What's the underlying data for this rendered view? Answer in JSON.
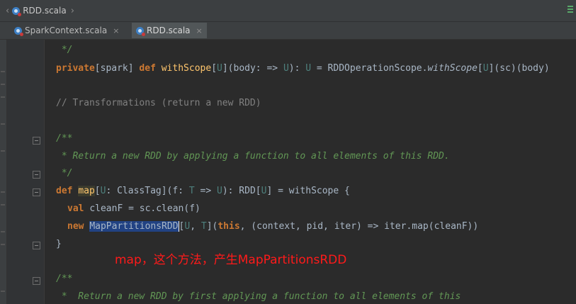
{
  "breadcrumb": {
    "file": "RDD.scala"
  },
  "tabs": [
    {
      "label": "SparkContext.scala",
      "close": "×"
    },
    {
      "label": "RDD.scala",
      "close": "×"
    }
  ],
  "code": {
    "l1": {
      "t1": " */"
    },
    "l2": {
      "t1": "private",
      "t2": "[spark] ",
      "t3": "def ",
      "t4": "withScope",
      "t5": "[",
      "t6": "U",
      "t7": "](body: => ",
      "t8": "U",
      "t9": "): ",
      "t10": "U",
      "t11": " = RDDOperationScope.",
      "t12": "withScope",
      "t13": "[",
      "t14": "U",
      "t15": "](sc)(body)"
    },
    "l3": {
      "t1": "// Transformations (return a new RDD)"
    },
    "l4": {
      "t1": "/**"
    },
    "l5": {
      "t1": " * Return a new RDD by applying a function to all elements of this RDD."
    },
    "l6": {
      "t1": " */"
    },
    "l7": {
      "t1": "def ",
      "t2": "map",
      "t3": "[",
      "t4": "U",
      "t5": ": ClassTag](f: ",
      "t6": "T",
      "t7": " => ",
      "t8": "U",
      "t9": "): RDD[",
      "t10": "U",
      "t11": "] = withScope {"
    },
    "l8": {
      "t1": "val ",
      "t2": "cleanF = sc.clean(f)"
    },
    "l9": {
      "t1": "new ",
      "t2": "MapPartitionsRDD",
      "t3": "[",
      "t4": "U",
      "t5": ", ",
      "t6": "T",
      "t7": "](",
      "t8": "this",
      "t9": ", (context, pid, iter) => iter.map(cleanF))"
    },
    "l10": {
      "t1": "}"
    },
    "l11": {
      "t1": "/**"
    },
    "l12": {
      "t1": " *  Return a new RDD by first applying a function to all elements of this"
    }
  },
  "annotation": "map，这个方法，产生MapPartitionsRDD",
  "colors": {
    "keyword": "#cc7832",
    "function": "#ffc66d",
    "type_param": "#4e807d",
    "comment": "#808080",
    "doc": "#629755",
    "annotation": "#ff1a1a"
  }
}
